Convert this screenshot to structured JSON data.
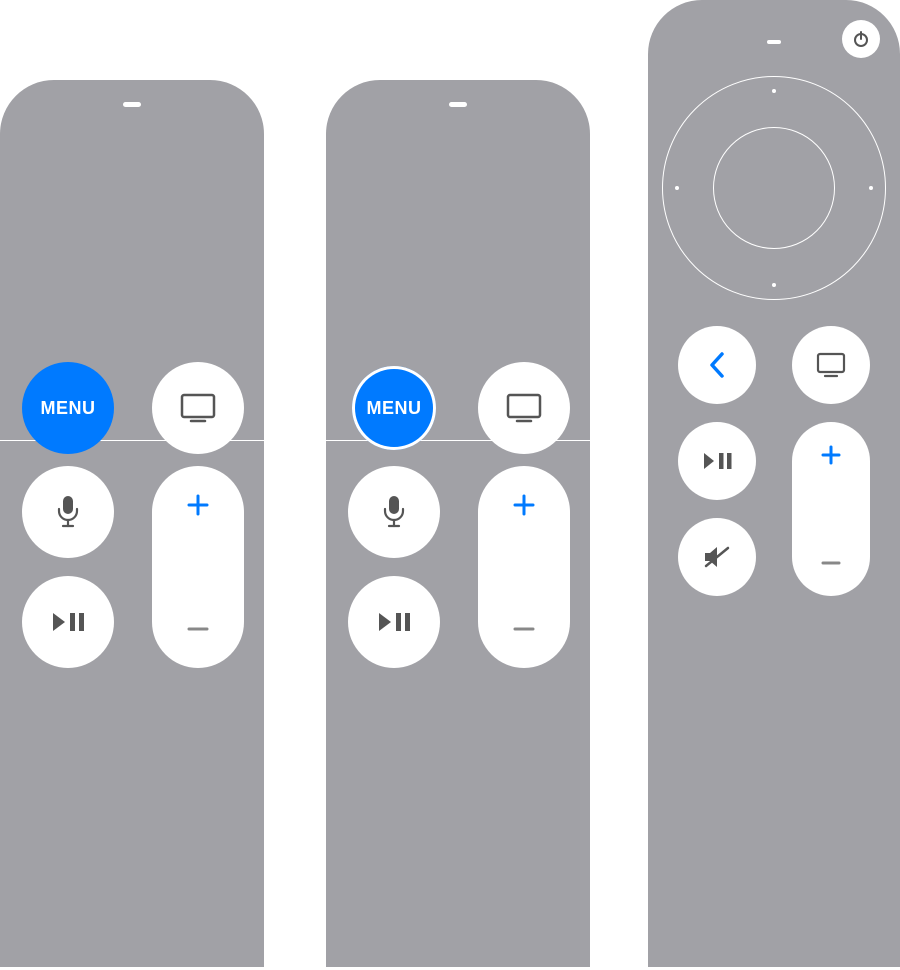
{
  "accent_blue": "#007aff",
  "remote_gray": "#a1a1a6",
  "remotes": [
    {
      "name": "siri-remote-1st-gen",
      "menu_label": "MENU",
      "menu_highlighted": true,
      "menu_ring": false,
      "buttons": {
        "tv": "tv-icon",
        "mic": "microphone-icon",
        "play": "play-pause-icon",
        "volume_up": "+",
        "volume_down": "−"
      }
    },
    {
      "name": "siri-remote-1st-gen-alt",
      "menu_label": "MENU",
      "menu_highlighted": true,
      "menu_ring": true,
      "buttons": {
        "tv": "tv-icon",
        "mic": "microphone-icon",
        "play": "play-pause-icon",
        "volume_up": "+",
        "volume_down": "−"
      }
    },
    {
      "name": "siri-remote-2nd-gen",
      "power": "power-icon",
      "clickpad": true,
      "buttons": {
        "back": "chevron-left-icon",
        "tv": "tv-icon",
        "play": "play-pause-icon",
        "mute": "mute-icon",
        "volume_up": "+",
        "volume_down": "−"
      }
    }
  ]
}
